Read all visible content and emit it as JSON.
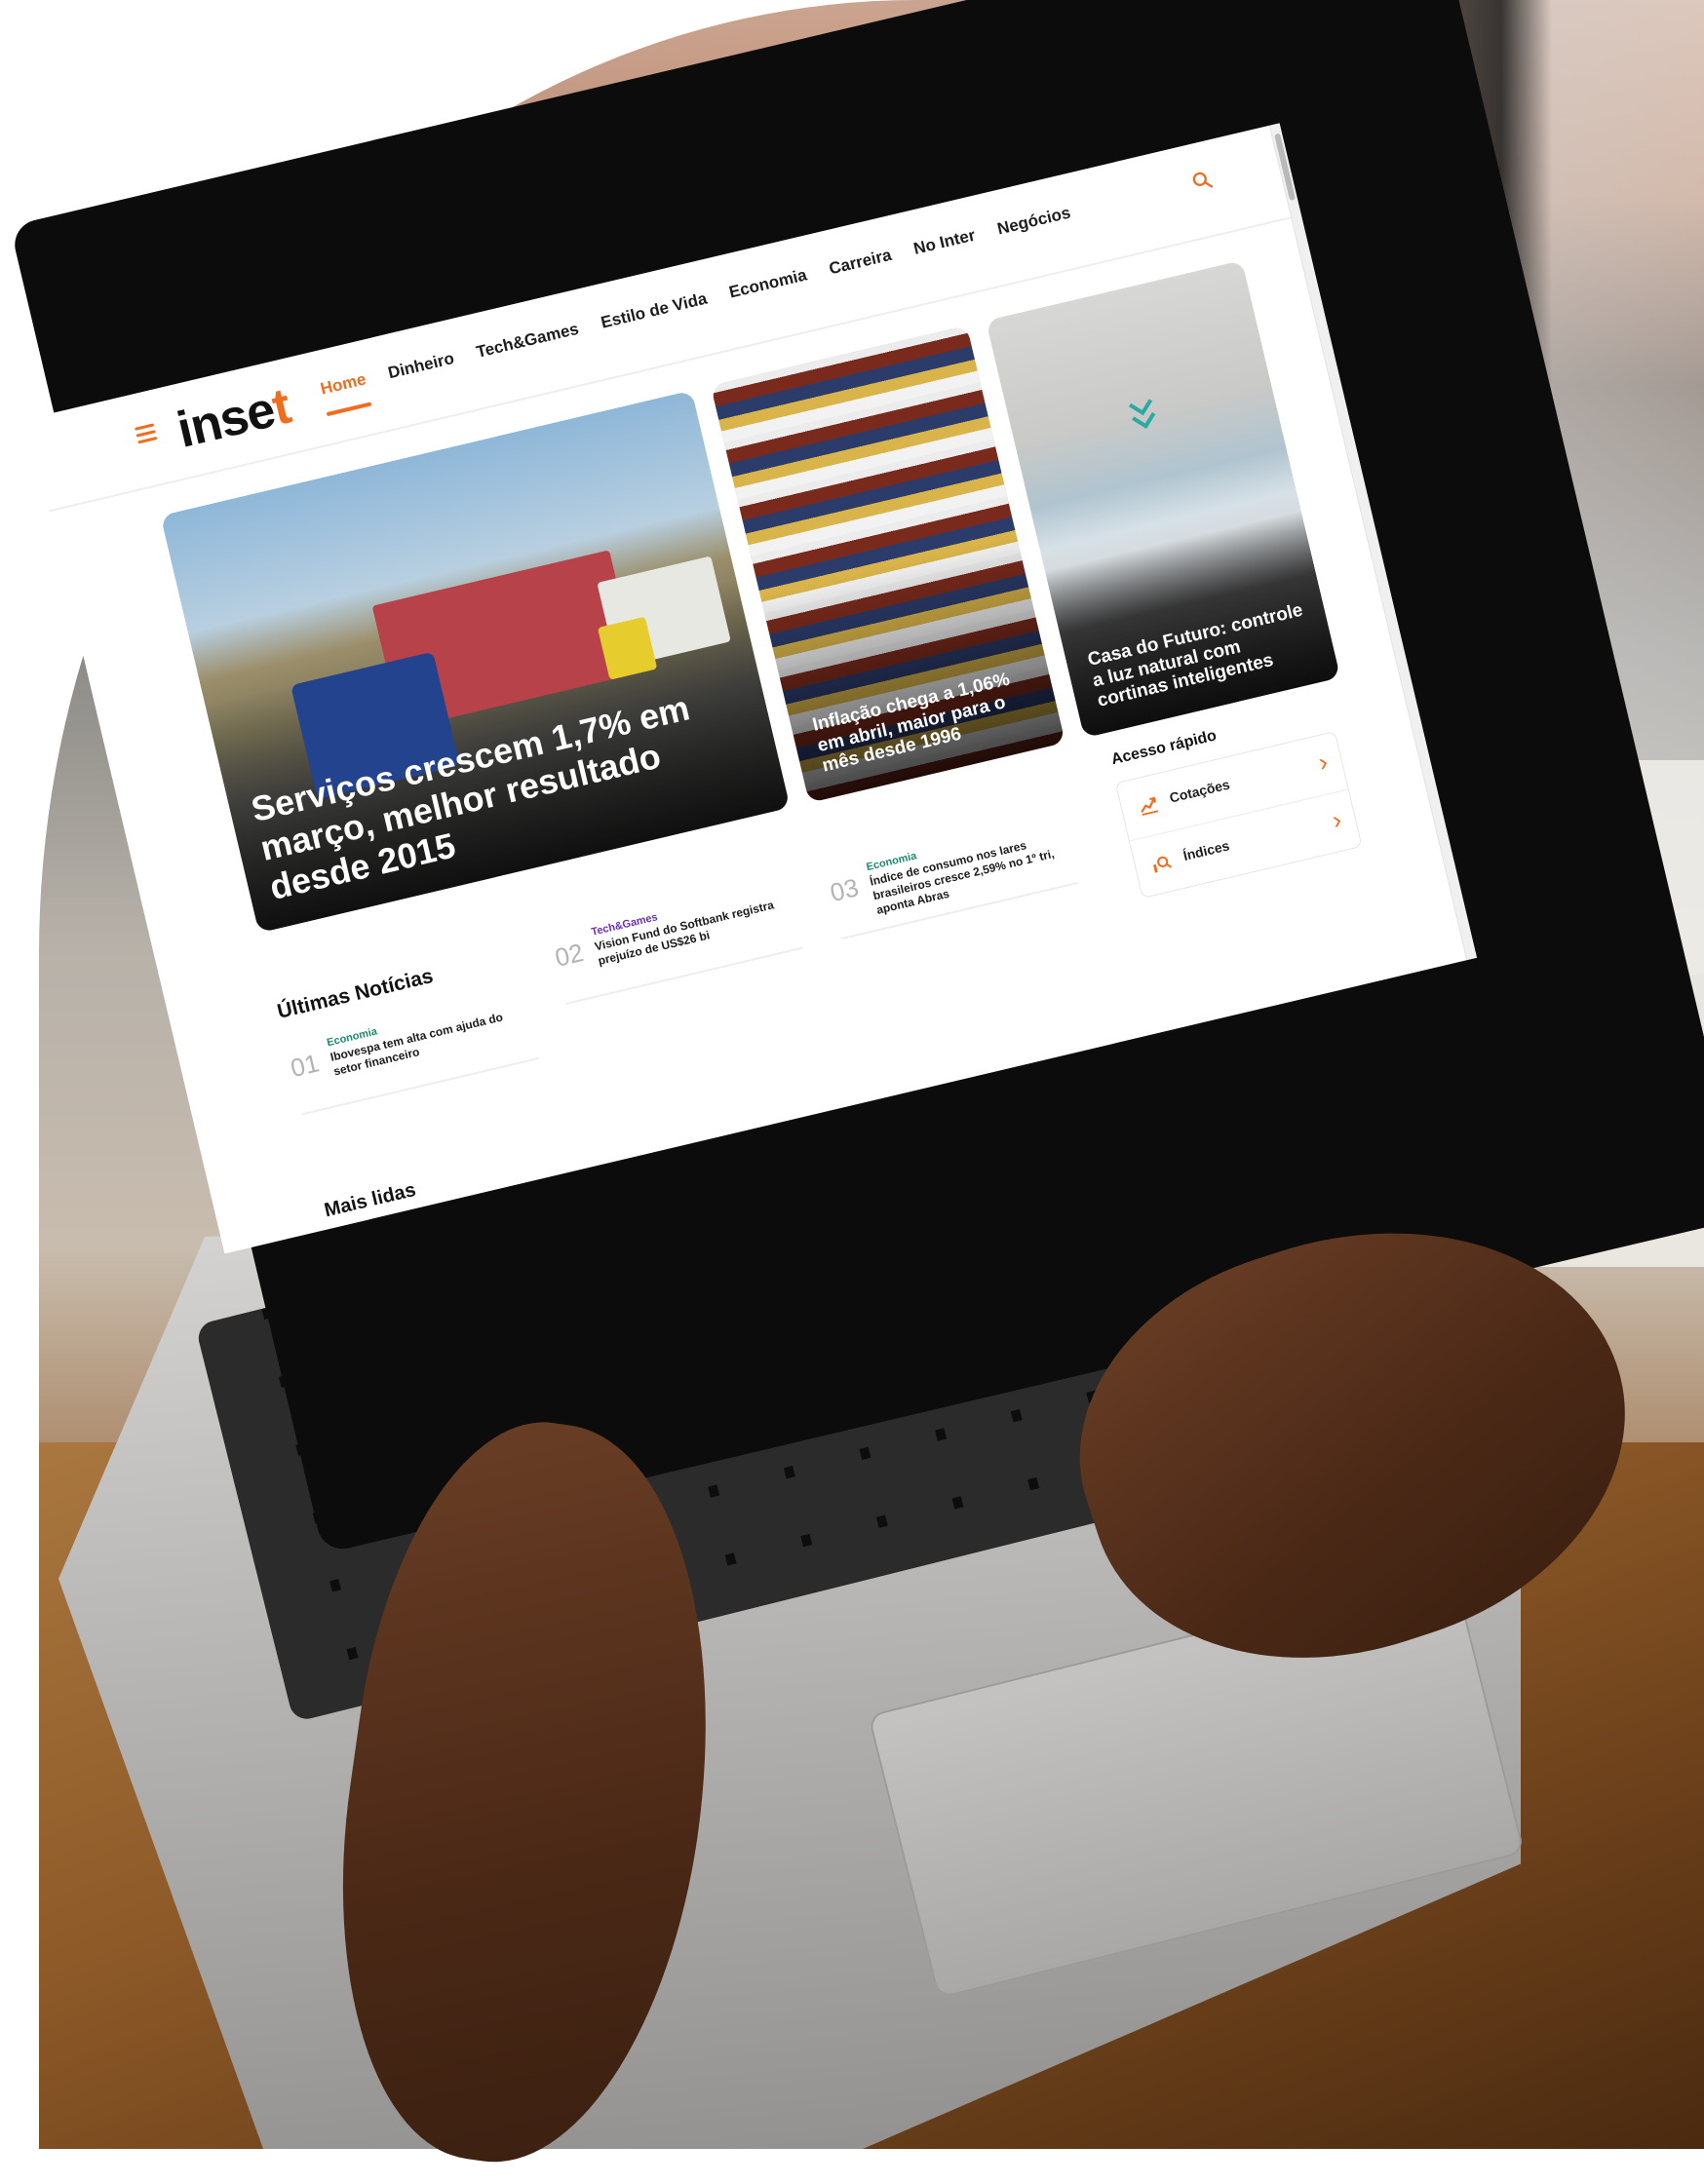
{
  "brand": {
    "logo_text": "inse",
    "logo_accent_letter": "t",
    "accent_color": "#f26c1e"
  },
  "nav": {
    "items": [
      {
        "label": "Home",
        "active": true
      },
      {
        "label": "Dinheiro",
        "active": false
      },
      {
        "label": "Tech&Games",
        "active": false
      },
      {
        "label": "Estilo de Vida",
        "active": false
      },
      {
        "label": "Economia",
        "active": false
      },
      {
        "label": "Carreira",
        "active": false
      },
      {
        "label": "No Inter",
        "active": false
      },
      {
        "label": "Negócios",
        "active": false
      }
    ],
    "search_icon": "search-icon",
    "menu_icon": "hamburger-menu-icon"
  },
  "hero": {
    "main": {
      "title": "Serviços crescem 1,7% em março, melhor resultado desde 2015"
    },
    "middle": {
      "title": "Inflação chega a 1,06% em abril, maior para o mês desde 1996"
    },
    "right": {
      "title": "Casa do Futuro: controle a luz natural com cortinas inteligentes"
    }
  },
  "latest_news": {
    "title": "Últimas Notícias",
    "items": [
      {
        "number": "01",
        "category": "Economia",
        "category_color": "#1a8a6a",
        "headline": "Ibovespa tem alta com ajuda do setor financeiro"
      },
      {
        "number": "02",
        "category": "Tech&Games",
        "category_color": "#6b2fb8",
        "headline": "Vision Fund do Softbank registra prejuízo de US$26 bi"
      },
      {
        "number": "03",
        "category": "Economia",
        "category_color": "#1a8a6a",
        "headline": "Índice de consumo nos lares brasileiros cresce 2,59% no 1º tri, aponta Abras"
      }
    ]
  },
  "quick_access": {
    "title": "Acesso rápido",
    "items": [
      {
        "label": "Cotações",
        "icon": "chart-up-icon"
      },
      {
        "label": "Índices",
        "icon": "index-search-icon"
      }
    ]
  },
  "most_read": {
    "title": "Mais lidas"
  }
}
